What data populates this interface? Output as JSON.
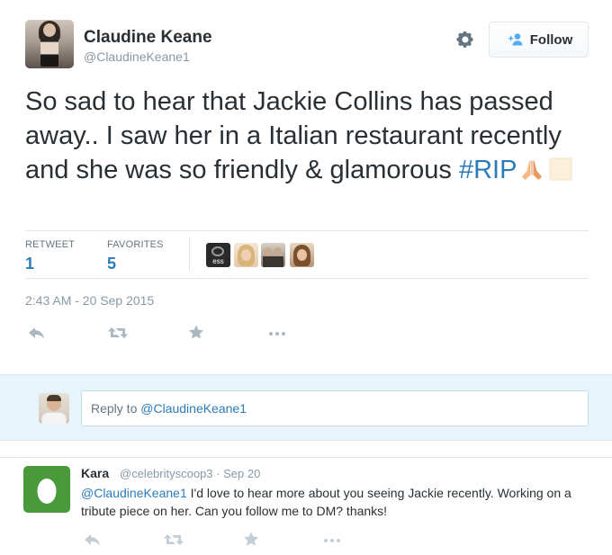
{
  "tweet": {
    "author": {
      "display_name": "Claudine Keane",
      "screen_name": "@ClaudineKeane1"
    },
    "follow_label": "Follow",
    "text_plain": "So sad to hear that Jackie Collins has passed away.. I saw her in a Italian restaurant recently and she was so friendly & glamorous ",
    "hashtag": "#RIP",
    "emoji": [
      "folded-hands-emoji",
      "blank-square-emoji"
    ],
    "stats": {
      "retweet_label": "RETWEET",
      "retweet_count": "1",
      "favorites_label": "FAVORITES",
      "favorites_count": "5"
    },
    "favoriter_avatars": [
      "ess",
      "",
      "",
      ""
    ],
    "timestamp": "2:43 AM - 20 Sep 2015",
    "actions": [
      "reply-icon",
      "retweet-icon",
      "favorite-icon",
      "more-icon"
    ]
  },
  "reply_box": {
    "prefix": "Reply to ",
    "mention": "@ClaudineKeane1"
  },
  "reply": {
    "display_name": "Kara",
    "screen_name": "@celebrityscoop3",
    "separator": "·",
    "date": "Sep 20",
    "mention": "@ClaudineKeane1",
    "text": " I'd love to hear more about you seeing Jackie recently. Working on a tribute piece on her. Can you follow me to DM? thanks!"
  },
  "colors": {
    "link": "#2b7bb9",
    "muted": "#8899a6",
    "reply_bg": "#e8f4fb",
    "kara_avatar_bg": "#4a9a3c"
  }
}
